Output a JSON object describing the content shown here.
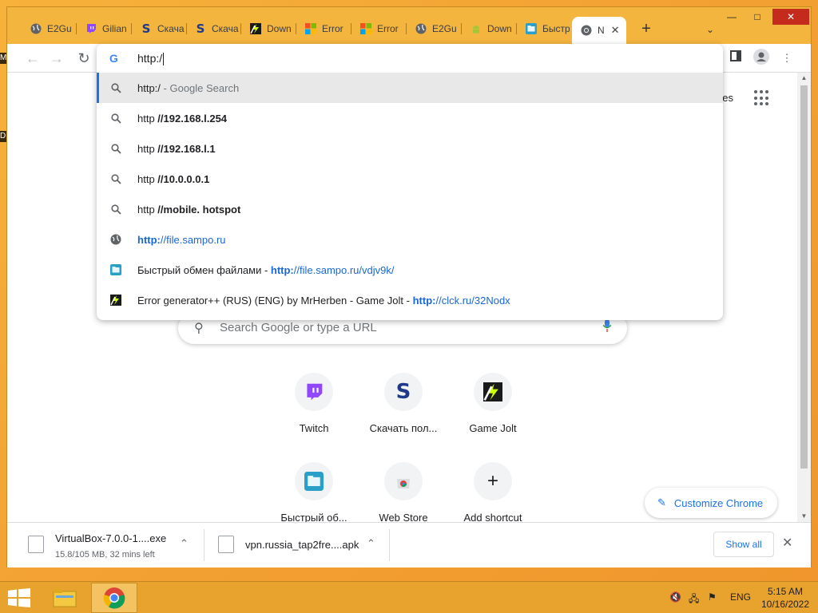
{
  "desktop": {
    "left_edge_labels": [
      "M",
      "D"
    ]
  },
  "browser": {
    "tabs": [
      {
        "title": "E2Gu",
        "icon": "globe-icon"
      },
      {
        "title": "Gilian",
        "icon": "twitch-icon"
      },
      {
        "title": "Скача",
        "icon": "s-logo-icon"
      },
      {
        "title": "Скача",
        "icon": "s-logo-icon"
      },
      {
        "title": "Down",
        "icon": "gamejolt-icon"
      },
      {
        "title": "Error",
        "icon": "windows-logo-icon"
      },
      {
        "title": "Error",
        "icon": "windows-logo-icon"
      },
      {
        "title": "E2Gu",
        "icon": "globe-icon"
      },
      {
        "title": "Down",
        "icon": "android-icon"
      },
      {
        "title": "Быстр",
        "icon": "folder-share-icon"
      },
      {
        "title": "N",
        "icon": "chrome-icon",
        "active": true
      }
    ],
    "window_controls": {
      "minimize": "—",
      "maximize": "□",
      "close": "✕"
    },
    "new_tab_symbol": "+",
    "tab_search_symbol": "⌄",
    "omnibox": {
      "typed_text": "http:/",
      "suggestions": [
        {
          "icon": "search-icon",
          "parts": [
            {
              "t": "http:/",
              "s": "plain"
            },
            {
              "t": " - Google Search",
              "s": "dim"
            }
          ],
          "selected": true
        },
        {
          "icon": "search-icon",
          "parts": [
            {
              "t": "http ",
              "s": "plain"
            },
            {
              "t": "//192.168.l.254",
              "s": "bold"
            }
          ]
        },
        {
          "icon": "search-icon",
          "parts": [
            {
              "t": "http ",
              "s": "plain"
            },
            {
              "t": "//192.168.l.1",
              "s": "bold"
            }
          ]
        },
        {
          "icon": "search-icon",
          "parts": [
            {
              "t": "http ",
              "s": "plain"
            },
            {
              "t": "//10.0.0.0.1",
              "s": "bold"
            }
          ]
        },
        {
          "icon": "search-icon",
          "parts": [
            {
              "t": "http ",
              "s": "plain"
            },
            {
              "t": "//mobile. hotspot",
              "s": "bold"
            }
          ]
        },
        {
          "icon": "globe-icon",
          "parts": [
            {
              "t": "http:",
              "s": "urlbold"
            },
            {
              "t": "//file.sampo.ru",
              "s": "url"
            }
          ]
        },
        {
          "icon": "folder-share-icon",
          "parts": [
            {
              "t": "Быстрый обмен файлами - ",
              "s": "plain"
            },
            {
              "t": "http:",
              "s": "urlbold"
            },
            {
              "t": "//file.sampo.ru/vdjv9k/",
              "s": "url"
            }
          ]
        },
        {
          "icon": "gamejolt-icon",
          "parts": [
            {
              "t": "Error generator++ (RUS) (ENG) by MrHerben - Game Jolt - ",
              "s": "plain"
            },
            {
              "t": "http:",
              "s": "urlbold"
            },
            {
              "t": "//clck.ru/32Nodx",
              "s": "url"
            }
          ]
        }
      ]
    },
    "ntp": {
      "images_link": "ges",
      "search_placeholder": "Search Google or type a URL",
      "shortcuts": [
        {
          "label": "Twitch",
          "icon": "twitch-icon"
        },
        {
          "label": "Скачать пол...",
          "icon": "s-logo-icon"
        },
        {
          "label": "Game Jolt",
          "icon": "gamejolt-icon"
        },
        {
          "label": "Быстрый об...",
          "icon": "folder-share-icon"
        },
        {
          "label": "Web Store",
          "icon": "webstore-icon"
        },
        {
          "label": "Add shortcut",
          "icon": "plus-icon"
        }
      ],
      "customize_label": "Customize Chrome"
    },
    "downloads": {
      "items": [
        {
          "name": "VirtualBox-7.0.0-1....exe",
          "status": "15.8/105 MB, 32 mins left"
        },
        {
          "name": "vpn.russia_tap2fre....apk",
          "status": ""
        }
      ],
      "show_all_label": "Show all"
    }
  },
  "taskbar": {
    "language": "ENG",
    "time": "5:15 AM",
    "date": "10/16/2022"
  },
  "colors": {
    "accent_blue": "#1a73e8",
    "titlebar": "#f4b53f",
    "taskbar": "#e8a22e"
  }
}
